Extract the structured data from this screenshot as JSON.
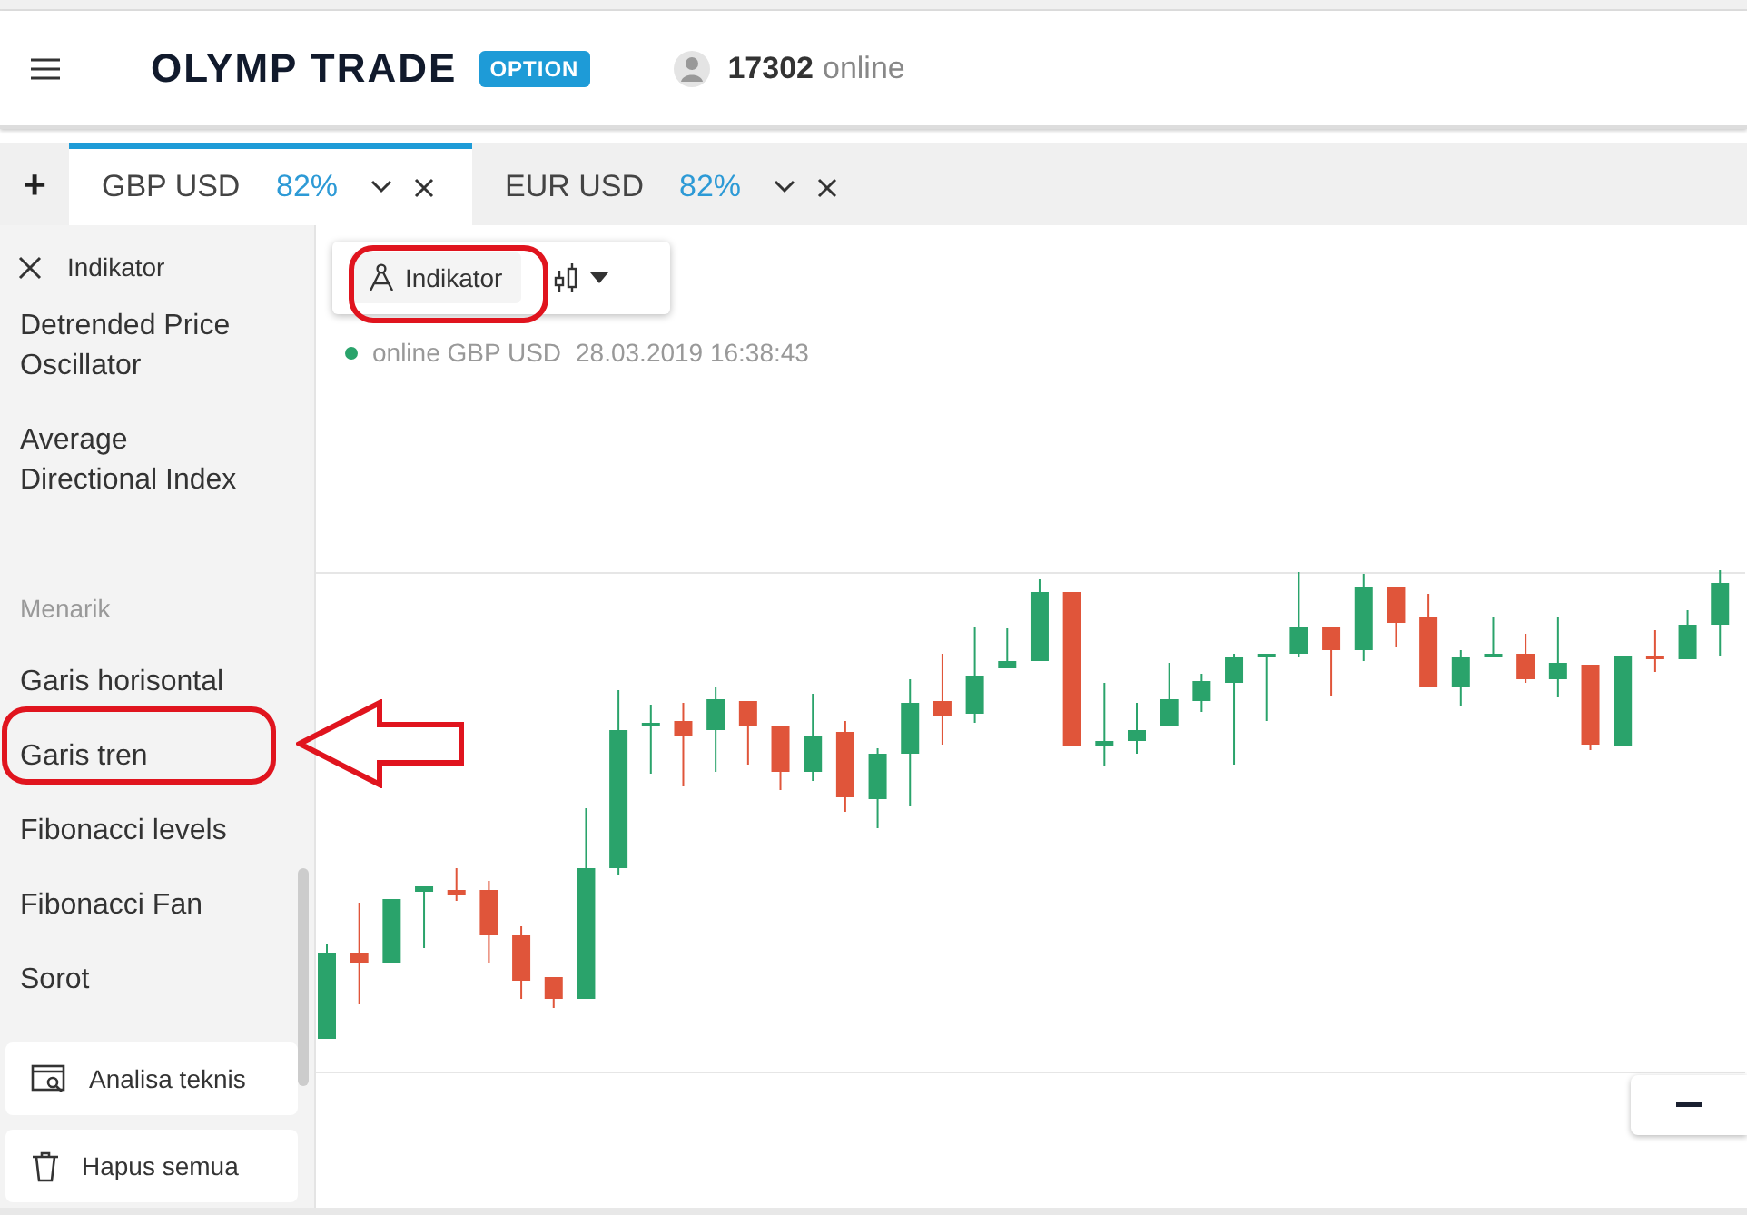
{
  "header": {
    "logo": "OLYMP TRADE",
    "badge": "OPTION",
    "online_count": "17302",
    "online_label": "online"
  },
  "add_tab": "+",
  "tabs": [
    {
      "symbol": "GBP USD",
      "payout": "82%",
      "selected": true
    },
    {
      "symbol": "EUR USD",
      "payout": "82%",
      "selected": false
    }
  ],
  "sidebar": {
    "title": "Indikator",
    "items": [
      {
        "kind": "item",
        "label": "Detrended Price Oscillator"
      },
      {
        "kind": "item",
        "label": "Average Directional Index"
      },
      {
        "kind": "section",
        "label": "Menarik"
      },
      {
        "kind": "item",
        "label": "Garis horisontal"
      },
      {
        "kind": "item",
        "label": "Garis tren"
      },
      {
        "kind": "item",
        "label": "Fibonacci levels"
      },
      {
        "kind": "item",
        "label": "Fibonacci Fan"
      },
      {
        "kind": "item",
        "label": "Sorot"
      }
    ],
    "buttons": [
      {
        "kind": "analysis",
        "label": "Analisa teknis"
      },
      {
        "kind": "delete",
        "label": "Hapus semua"
      }
    ]
  },
  "chart_toolbar": {
    "indicator_button": "Indikator"
  },
  "status": {
    "label": "online GBP USD",
    "timestamp": "28.03.2019 16:38:43"
  }
}
